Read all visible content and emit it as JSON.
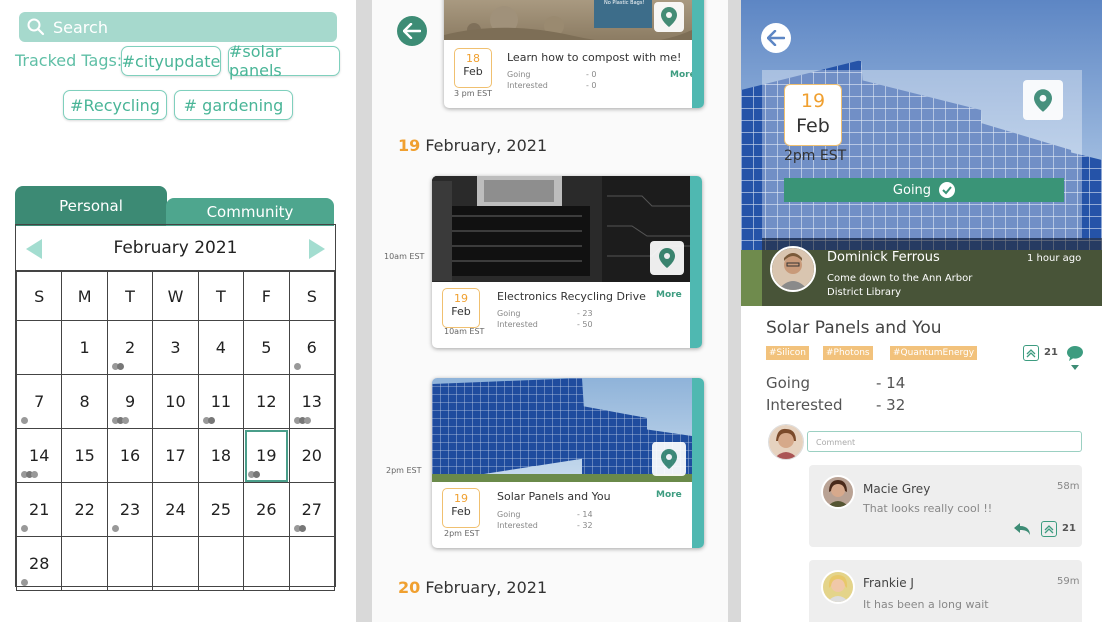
{
  "search": {
    "placeholder": "Search"
  },
  "tracked_label": "Tracked Tags:",
  "tags": [
    "#cityupdate",
    "#solar panels",
    "#Recycling",
    "# gardening"
  ],
  "tabs": {
    "personal": "Personal",
    "community": "Community"
  },
  "calendar": {
    "month": "February 2021",
    "dow": [
      "S",
      "M",
      "T",
      "W",
      "T",
      "F",
      "S"
    ],
    "weeks": [
      [
        "",
        "1",
        "2",
        "3",
        "4",
        "5",
        "6"
      ],
      [
        "7",
        "8",
        "9",
        "10",
        "11",
        "12",
        "13"
      ],
      [
        "14",
        "15",
        "16",
        "17",
        "18",
        "19",
        "20"
      ],
      [
        "21",
        "22",
        "23",
        "24",
        "25",
        "26",
        "27"
      ],
      [
        "28",
        "",
        "",
        "",
        "",
        "",
        ""
      ]
    ],
    "selected": "19",
    "event_dots": {
      "2": 2,
      "6": 1,
      "7": 1,
      "9": 3,
      "11": 2,
      "13": 3,
      "14": 3,
      "19": 2,
      "21": 1,
      "23": 1,
      "27": 2,
      "28": 1
    }
  },
  "feed": {
    "card1": {
      "day": "18",
      "month": "Feb",
      "time": "3 pm EST",
      "title": "Learn how to compost with me!",
      "going_label": "Going",
      "going": "- 0",
      "interested_label": "Interested",
      "interested": "- 0",
      "more": "More",
      "sign_text": "No Plastic Bags!"
    },
    "day19": {
      "num": "19",
      "rest": " February, 2021"
    },
    "card2": {
      "side_time": "10am EST",
      "day": "19",
      "month": "Feb",
      "time": "10am EST",
      "title": "Electronics Recycling Drive",
      "going_label": "Going",
      "going": "- 23",
      "interested_label": "Interested",
      "interested": "- 50",
      "more": "More"
    },
    "card3": {
      "side_time": "2pm EST",
      "day": "19",
      "month": "Feb",
      "time": "2pm EST",
      "title": "Solar Panels and You",
      "going_label": "Going",
      "going": "- 14",
      "interested_label": "Interested",
      "interested": "- 32",
      "more": "More"
    },
    "day20": {
      "num": "20",
      "rest": " February, 2021"
    }
  },
  "detail": {
    "day": "19",
    "month": "Feb",
    "time": "2pm EST",
    "going_btn": "Going",
    "host_name": "Dominick Ferrous",
    "host_msg_1": "Come down to the Ann Arbor",
    "host_msg_2": "District Library",
    "posted": "1 hour ago",
    "title": "Solar Panels and You",
    "tags": [
      "#Silicon",
      "#Photons",
      "#QuantumEnergy"
    ],
    "upvotes": "21",
    "going_label": "Going",
    "going": "- 14",
    "interested_label": "Interested",
    "interested": "- 32",
    "comment_placeholder": "Comment",
    "replies": [
      {
        "name": "Macie Grey",
        "text": "That looks really cool !!",
        "time": "58m",
        "upvotes": "21"
      },
      {
        "name": "Frankie J",
        "text": "It has been a long wait",
        "time": "59m"
      }
    ]
  },
  "colors": {
    "primary": "#3d8c75",
    "accent": "#4fb8b1",
    "tab_dark": "#3c8a74",
    "tab_light": "#4ea68e",
    "date_orange": "#f0a030",
    "search_bg": "#a6d9cd"
  }
}
